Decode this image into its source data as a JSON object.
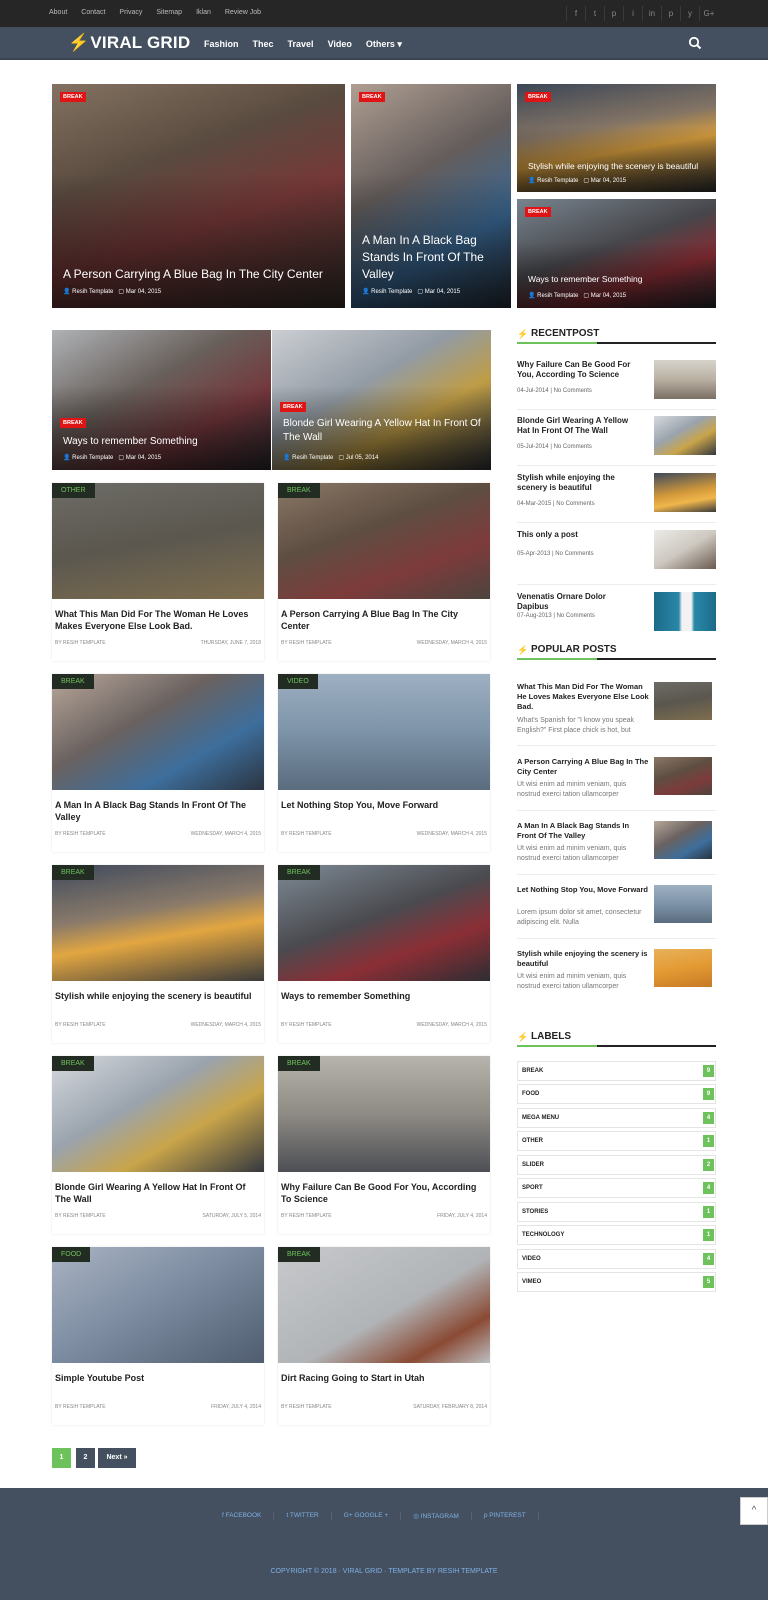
{
  "topbar": {
    "links": [
      "About",
      "Contact",
      "Privacy",
      "Sitemap",
      "Iklan",
      "Review Job"
    ]
  },
  "social": [
    "f",
    "t",
    "p",
    "i",
    "in",
    "p",
    "y",
    "G+"
  ],
  "nav": {
    "logo": "VIRAL GRID",
    "menu": [
      "Fashion",
      "Thec",
      "Travel",
      "Video",
      "Others ▾"
    ]
  },
  "hero": [
    {
      "badge": "BREAK",
      "title": "A Person Carrying A Blue Bag In The City Center",
      "author": "Resih Template",
      "date": "Mar 04, 2015"
    },
    {
      "badge": "BREAK",
      "title": "A Man In A Black Bag Stands In Front Of The Valley",
      "author": "Resih Template",
      "date": "Mar 04, 2015"
    },
    {
      "badge": "BREAK",
      "title": "Stylish while enjoying the scenery is beautiful",
      "author": "Resih Template",
      "date": "Mar 04, 2015"
    },
    {
      "badge": "BREAK",
      "title": "Ways to remember Something",
      "author": "Resih Template",
      "date": "Mar 04, 2015"
    },
    {
      "badge": "BREAK",
      "title": "Ways to remember Something",
      "author": "Resih Template",
      "date": "Mar 04, 2015"
    },
    {
      "badge": "BREAK",
      "title": "Blonde Girl Wearing A Yellow Hat In Front Of The Wall",
      "author": "Resih Template",
      "date": "Jul 05, 2014"
    }
  ],
  "cards": [
    {
      "cat": "OTHER",
      "title": "What This Man Did For The Woman He Loves Makes Everyone Else Look Bad.",
      "by": "BY RESIH TEMPLATE",
      "date": "THURSDAY, JUNE 7, 2018"
    },
    {
      "cat": "BREAK",
      "title": "A Person Carrying A Blue Bag In The City Center",
      "by": "BY RESIH TEMPLATE",
      "date": "WEDNESDAY, MARCH 4, 2015"
    },
    {
      "cat": "BREAK",
      "title": "A Man In A Black Bag Stands In Front Of The Valley",
      "by": "BY RESIH TEMPLATE",
      "date": "WEDNESDAY, MARCH 4, 2015"
    },
    {
      "cat": "VIDEO",
      "title": "Let Nothing Stop You, Move Forward",
      "by": "BY RESIH TEMPLATE",
      "date": "WEDNESDAY, MARCH 4, 2015"
    },
    {
      "cat": "BREAK",
      "title": "Stylish while enjoying the scenery is beautiful",
      "by": "BY RESIH TEMPLATE",
      "date": "WEDNESDAY, MARCH 4, 2015"
    },
    {
      "cat": "BREAK",
      "title": "Ways to remember Something",
      "by": "BY RESIH TEMPLATE",
      "date": "WEDNESDAY, MARCH 4, 2015"
    },
    {
      "cat": "BREAK",
      "title": "Blonde Girl Wearing A Yellow Hat In Front Of The Wall",
      "by": "BY RESIH TEMPLATE",
      "date": "SATURDAY, JULY 5, 2014"
    },
    {
      "cat": "BREAK",
      "title": "Why Failure Can Be Good For You, According To Science",
      "by": "BY RESIH TEMPLATE",
      "date": "FRIDAY, JULY 4, 2014"
    },
    {
      "cat": "FOOD",
      "title": "Simple Youtube Post",
      "by": "BY RESIH TEMPLATE",
      "date": "FRIDAY, JULY 4, 2014"
    },
    {
      "cat": "BREAK",
      "title": "Dirt Racing Going to Start in Utah",
      "by": "BY RESIH TEMPLATE",
      "date": "SATURDAY, FEBRUARY 8, 2014"
    }
  ],
  "sidebar": {
    "recent_title": "RECENTPOST",
    "recent": [
      {
        "title": "Why Failure Can Be Good For You, According To Science",
        "meta": "04-Jul-2014 | No Comments"
      },
      {
        "title": "Blonde Girl Wearing A Yellow Hat In Front Of The Wall",
        "meta": "05-Jul-2014 | No Comments"
      },
      {
        "title": "Stylish while enjoying the scenery is beautiful",
        "meta": "04-Mar-2015 | No Comments"
      },
      {
        "title": "This only a post",
        "meta": "05-Apr-2013 | No Comments"
      },
      {
        "title": "Venenatis Ornare Dolor Dapibus",
        "meta": "07-Aug-2013 | No Comments"
      }
    ],
    "popular_title": "POPULAR POSTS",
    "popular": [
      {
        "title": "What This Man Did For The Woman He Loves Makes Everyone Else Look Bad.",
        "desc": "What's Spanish for \"I know you speak English?\" First place chick is hot, but"
      },
      {
        "title": "A Person Carrying A Blue Bag In The City Center",
        "desc": "Ut wisi enim ad minim veniam, quis nostrud exerci tation ullamcorper"
      },
      {
        "title": "A Man In A Black Bag Stands In Front Of The Valley",
        "desc": "Ut wisi enim ad minim veniam, quis nostrud exerci tation ullamcorper"
      },
      {
        "title": "Let Nothing Stop You, Move Forward",
        "desc": "Lorem ipsum dolor sit amet, consectetur adipiscing elit. Nulla"
      },
      {
        "title": "Stylish while enjoying the scenery is beautiful",
        "desc": "Ut wisi enim ad minim veniam, quis nostrud exerci tation ullamcorper"
      }
    ],
    "labels_title": "LABELS",
    "labels": [
      {
        "name": "BREAK",
        "count": "9"
      },
      {
        "name": "FOOD",
        "count": "9"
      },
      {
        "name": "MEGA MENU",
        "count": "4"
      },
      {
        "name": "OTHER",
        "count": "1"
      },
      {
        "name": "SLIDER",
        "count": "2"
      },
      {
        "name": "SPORT",
        "count": "4"
      },
      {
        "name": "STORIES",
        "count": "1"
      },
      {
        "name": "TECHNOLOGY",
        "count": "1"
      },
      {
        "name": "VIDEO",
        "count": "4"
      },
      {
        "name": "VIMEO",
        "count": "5"
      }
    ]
  },
  "pagination": {
    "p1": "1",
    "p2": "2",
    "next": "Next »"
  },
  "footer": {
    "links": [
      "f  FACEBOOK",
      "t  TWITTER",
      "G+  GOOGLE +",
      "◎  INSTAGRAM",
      "p  PINTEREST"
    ],
    "copyright": "COPYRIGHT © 2018 · VIRAL GRID · TEMPLATE BY RESIH TEMPLATE",
    "totop": "^"
  },
  "colors": {
    "accent": "#6ec25c",
    "badge": "#e01414",
    "nav": "#44505f",
    "topbar": "#262626"
  }
}
